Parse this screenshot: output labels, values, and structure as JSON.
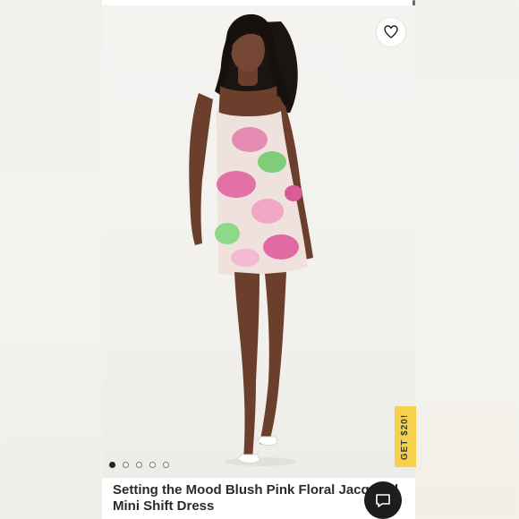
{
  "gallery": {
    "slide_count": 5,
    "active_slide": 1
  },
  "promo": {
    "label": "GET $20!",
    "color": "#f6d24c"
  },
  "product": {
    "title_line1": "Setting the Mood Blush Pink Floral Jacquard",
    "title_line2": "Mini Shift Dress"
  },
  "icons": {
    "wishlist": "heart-icon",
    "chat": "chat-bubble-icon"
  }
}
